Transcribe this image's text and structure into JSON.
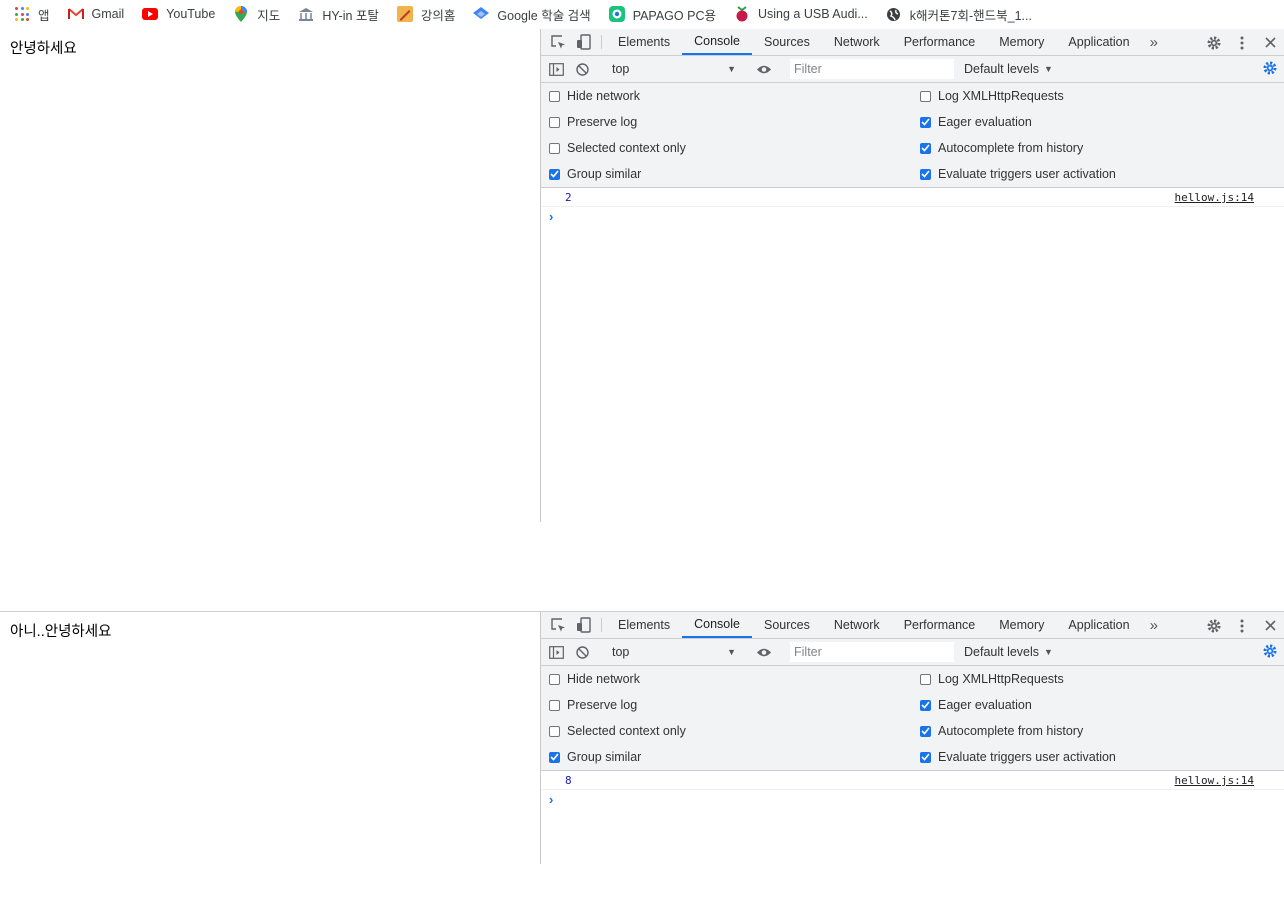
{
  "bookmarks": [
    {
      "icon": "apps-grid-icon",
      "label": "앱"
    },
    {
      "icon": "gmail-icon",
      "label": "Gmail"
    },
    {
      "icon": "youtube-icon",
      "label": "YouTube"
    },
    {
      "icon": "maps-pin-icon",
      "label": "지도"
    },
    {
      "icon": "building-icon",
      "label": "HY-in 포탈"
    },
    {
      "icon": "pencil-note-icon",
      "label": "강의홈"
    },
    {
      "icon": "scholar-cap-icon",
      "label": "Google 학술 검색"
    },
    {
      "icon": "papago-icon",
      "label": "PAPAGO PC용"
    },
    {
      "icon": "raspberry-icon",
      "label": "Using a USB Audi..."
    },
    {
      "icon": "globe-icon",
      "label": "k해커톤7회-핸드북_1..."
    }
  ],
  "devtools": {
    "tabs": [
      "Elements",
      "Console",
      "Sources",
      "Network",
      "Performance",
      "Memory",
      "Application"
    ],
    "active_tab": "Console",
    "more_tabs": "»",
    "context": "top",
    "filter_placeholder": "Filter",
    "levels": "Default levels",
    "settings_left": [
      {
        "label": "Hide network",
        "checked": false
      },
      {
        "label": "Preserve log",
        "checked": false
      },
      {
        "label": "Selected context only",
        "checked": false
      },
      {
        "label": "Group similar",
        "checked": true
      }
    ],
    "settings_right": [
      {
        "label": "Log XMLHttpRequests",
        "checked": false
      },
      {
        "label": "Eager evaluation",
        "checked": true
      },
      {
        "label": "Autocomplete from history",
        "checked": true
      },
      {
        "label": "Evaluate triggers user activation",
        "checked": true
      }
    ],
    "prompt": "›"
  },
  "screens": [
    {
      "page_text": "안녕하세요",
      "log_value": "2",
      "log_source": "hellow.js:14"
    },
    {
      "page_text": "아니..안녕하세요",
      "log_value": "8",
      "log_source": "hellow.js:14"
    }
  ],
  "colors": {
    "accent": "#1a73e8",
    "youtube": "#ff0000"
  }
}
